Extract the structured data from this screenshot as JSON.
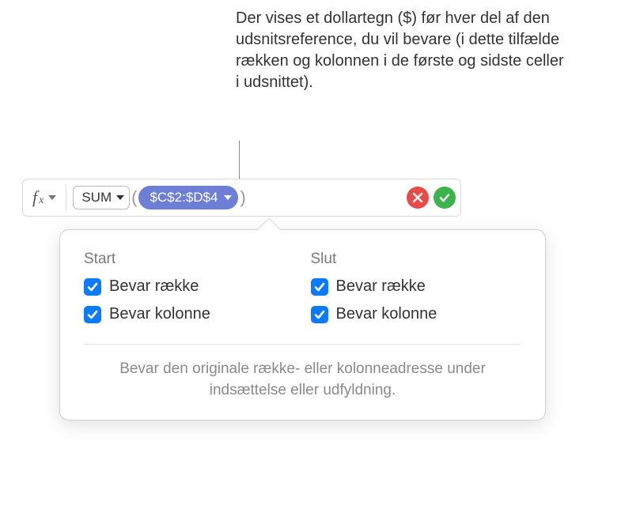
{
  "callout": {
    "text": "Der vises et dollartegn ($) før hver del af den udsnitsreference, du vil bevare (i dette tilfælde rækken og kolonnen i de første og sidste celler i udsnittet)."
  },
  "formula_bar": {
    "fx_label_main": "f",
    "fx_label_sub": "x",
    "function_name": "SUM",
    "range_ref": "$C$2:$D$4"
  },
  "actions": {
    "cancel_icon": "x-icon",
    "confirm_icon": "check-icon"
  },
  "popover": {
    "start": {
      "header": "Start",
      "keep_row_label": "Bevar række",
      "keep_col_label": "Bevar kolonne"
    },
    "end": {
      "header": "Slut",
      "keep_row_label": "Bevar række",
      "keep_col_label": "Bevar kolonne"
    },
    "explanation": "Bevar den originale række- eller kolonneadresse under indsættelse eller udfyldning."
  }
}
